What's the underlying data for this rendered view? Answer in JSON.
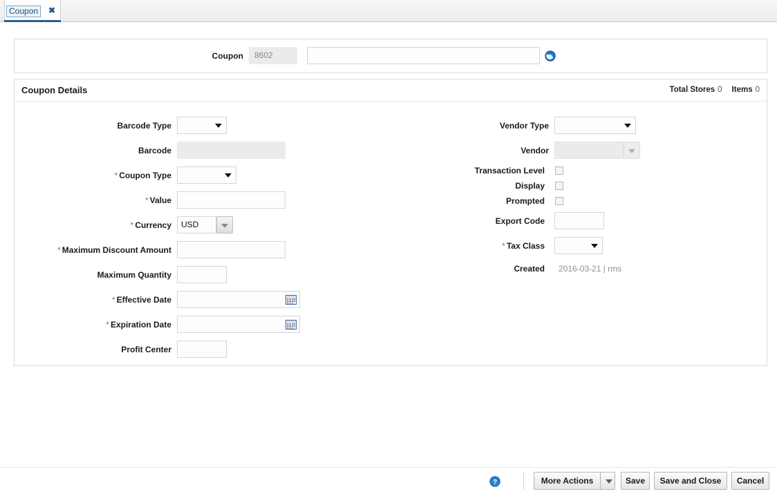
{
  "tab": {
    "label": "Coupon",
    "close_label": "✖"
  },
  "header": {
    "coupon_label": "Coupon",
    "coupon_id": "8602",
    "coupon_description": "",
    "coupon_description_placeholder": "",
    "translate_icon": "globe-icon"
  },
  "details": {
    "title": "Coupon Details",
    "total_stores_label": "Total Stores",
    "total_stores_value": "0",
    "items_label": "Items",
    "items_value": "0"
  },
  "left_fields": {
    "barcode_type": {
      "label": "Barcode Type",
      "value": "",
      "required": false
    },
    "barcode": {
      "label": "Barcode",
      "value": "",
      "required": false
    },
    "coupon_type": {
      "label": "Coupon Type",
      "value": "",
      "required": true
    },
    "value": {
      "label": "Value",
      "value": "",
      "required": true
    },
    "currency": {
      "label": "Currency",
      "value": "USD",
      "required": true
    },
    "maximum_discount_amount": {
      "label": "Maximum Discount Amount",
      "value": "",
      "required": true
    },
    "maximum_quantity": {
      "label": "Maximum Quantity",
      "value": "",
      "required": false
    },
    "effective_date": {
      "label": "Effective Date",
      "value": "",
      "required": true,
      "icon": "calendar-icon"
    },
    "expiration_date": {
      "label": "Expiration Date",
      "value": "",
      "required": true,
      "icon": "calendar-icon"
    },
    "profit_center": {
      "label": "Profit Center",
      "value": "",
      "required": false
    }
  },
  "right_fields": {
    "vendor_type": {
      "label": "Vendor Type",
      "value": "",
      "required": false
    },
    "vendor": {
      "label": "Vendor",
      "value": "",
      "required": false
    },
    "transaction_level": {
      "label": "Transaction Level",
      "checked": false
    },
    "display": {
      "label": "Display",
      "checked": false
    },
    "prompted": {
      "label": "Prompted",
      "checked": false
    },
    "export_code": {
      "label": "Export Code",
      "value": "",
      "required": false
    },
    "tax_class": {
      "label": "Tax Class",
      "value": "",
      "required": true
    },
    "created": {
      "label": "Created",
      "value": "2016-03-21 | rms"
    }
  },
  "required_marker": "*",
  "footer": {
    "help_icon": "help-icon",
    "more_actions": "More Actions",
    "save": "Save",
    "save_and_close": "Save and Close",
    "cancel": "Cancel"
  },
  "colors": {
    "accent": "#2a5d87",
    "required": "#4a7ebb",
    "link": "#1a4f7a",
    "disabled_bg": "#ebebeb",
    "field_border": "#cfd6dd"
  }
}
